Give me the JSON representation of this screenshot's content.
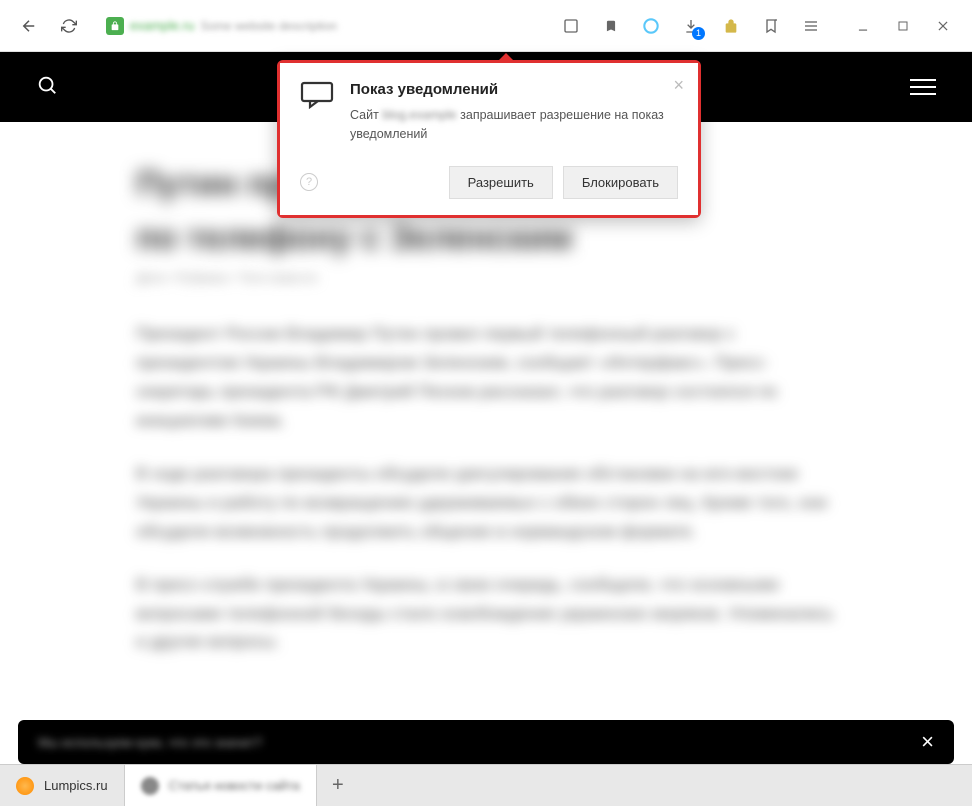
{
  "toolbar": {
    "url_host": "example.ru",
    "url_desc": "Some website description",
    "download_badge": "1"
  },
  "dialog": {
    "title": "Показ уведомлений",
    "desc_prefix": "Сайт",
    "site": "blog.example",
    "desc_suffix": "запрашивает разрешение на показ уведомлений",
    "allow": "Разрешить",
    "block": "Блокировать",
    "close": "×",
    "help": "?"
  },
  "article": {
    "title_l1": "Путин провел первый разговор",
    "title_l2": "по телефону с Зеленским",
    "meta": "Дата • Рубрика • Теги новости",
    "p1": "Президент России Владимир Путин провел первый телефонный разговор с президентом Украины Владимиром Зеленским, сообщает «Интерфакс». Пресс-секретарь президента РФ Дмитрий Песков рассказал, что разговор состоялся по инициативе Киева.",
    "p2": "В ходе разговора президенты обсудили урегулирование обстановки на юго-востоке Украины и работу по возвращению удерживаемых с обеих сторон лиц. Кроме того, они обсудили возможность продолжить общение в нормандском формате.",
    "p3": "В пресс-службе президента Украины, в свою очередь, сообщили, что основными вопросами телефонной беседы стало освобождение украинских моряков. Упоминались и другие вопросы."
  },
  "cookie": {
    "text": "Мы используем куки, что это значит?",
    "close": "×"
  },
  "tabs": {
    "t1": "Lumpics.ru",
    "t2": "Статья новости сайта",
    "new": "+"
  }
}
